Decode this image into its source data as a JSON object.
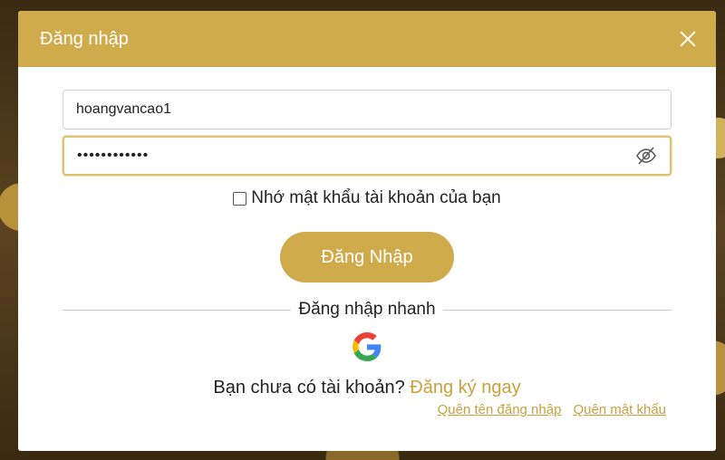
{
  "modal": {
    "title": "Đăng nhập"
  },
  "form": {
    "username_value": "hoangvancao1",
    "password_value": "••••••••••••",
    "remember_label": "Nhớ mật khẩu tài khoản của bạn",
    "remember_checked": false,
    "login_button": "Đăng Nhập"
  },
  "quick_login": {
    "label": "Đăng nhập nhanh",
    "providers": [
      "google-icon"
    ]
  },
  "signup": {
    "prompt": "Bạn chưa có tài khoản?",
    "link": "Đăng ký ngay"
  },
  "links": {
    "forgot_username": "Quên tên đăng nhập",
    "forgot_password": "Quên mật khẩu"
  },
  "colors": {
    "accent": "#d0ab4c",
    "link": "#c9a13e"
  },
  "icons": {
    "close": "close-icon",
    "password_toggle": "eye-off-icon"
  }
}
